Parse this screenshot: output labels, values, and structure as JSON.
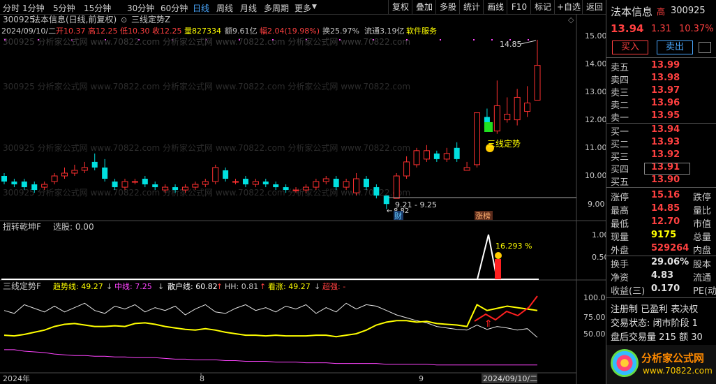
{
  "toolbar": {
    "periods": [
      "分时",
      "1分钟",
      "5分钟",
      "15分钟",
      "30分钟",
      "60分钟",
      "日线",
      "周线",
      "月线",
      "多周期",
      "更多"
    ],
    "active_period": "日线",
    "buttons": [
      "复权",
      "叠加",
      "多股",
      "统计",
      "画线",
      "F10",
      "标记",
      "+自选",
      "返回"
    ]
  },
  "main_chart": {
    "title_code": "300925",
    "title_name": "法本信息(日线,前复权)",
    "indicator_name": "三线定势Z",
    "info_date": "2024/09/10/二",
    "info_open": "开10.37",
    "info_high": "高12.25",
    "info_low": "低10.30",
    "info_close": "收12.25",
    "info_volume": "量827334",
    "info_amount": "额9.61亿",
    "info_change": "幅2.04(19.98%)",
    "info_turnover": "换25.97%",
    "info_float": "流通3.19亿",
    "info_sector": "软件服务",
    "price_axis": [
      "15.00",
      "14.00",
      "13.00",
      "12.00",
      "11.00",
      "10.00",
      "9.00"
    ],
    "annotation_high": "14.85",
    "annotation_low_range": "9.21 - 9.25",
    "annotation_low": "8.82",
    "signal_label": "三线定势",
    "badge_cai": "财",
    "badge_zhangting": "涨榜",
    "watermark": "300925 分析家公式网 www.70822.com 分析家公式网 www.70822.com 分析家公式网 www.70822.com"
  },
  "sub_chart1": {
    "title": "扭转乾坤F",
    "select_label": "选股: 0.00",
    "axis": [
      "1.00",
      "0.50"
    ],
    "peak_label": "16.293 %"
  },
  "sub_chart2": {
    "title": "三线定势F",
    "trend_label": "趋势线: 49.27",
    "mid_label": "中线: 7.25",
    "retail_label": "散户线: 60.82",
    "hh_label": "HH: 0.81",
    "rise_label": "看涨: 49.27",
    "strong_label": "超强: -",
    "axis": [
      "100.0",
      "75.00",
      "50.00"
    ],
    "x_axis": [
      "2024年",
      "8",
      "9",
      "2024/09/10/二"
    ]
  },
  "quote_panel": {
    "name": "法本信息",
    "tag": "高",
    "code": "300925",
    "price": "13.94",
    "change": "1.31",
    "change_pct": "10.37%",
    "buy_button": "买入",
    "sell_button": "卖出",
    "sell_levels": [
      {
        "label": "卖五",
        "price": "13.99"
      },
      {
        "label": "卖四",
        "price": "13.98"
      },
      {
        "label": "卖三",
        "price": "13.97"
      },
      {
        "label": "卖二",
        "price": "13.96"
      },
      {
        "label": "卖一",
        "price": "13.95"
      }
    ],
    "buy_levels": [
      {
        "label": "买一",
        "price": "13.94"
      },
      {
        "label": "买二",
        "price": "13.93"
      },
      {
        "label": "买三",
        "price": "13.92"
      },
      {
        "label": "买四",
        "price": "13.91"
      },
      {
        "label": "买五",
        "price": "13.90"
      }
    ],
    "stats": [
      {
        "label": "涨停",
        "value": "15.16",
        "extra": "跌停"
      },
      {
        "label": "最高",
        "value": "14.85",
        "extra": "量比"
      },
      {
        "label": "最低",
        "value": "12.70",
        "extra": "市值"
      },
      {
        "label": "现量",
        "value": "9175",
        "extra": "总量"
      },
      {
        "label": "外盘",
        "value": "529264",
        "extra": "内盘"
      }
    ],
    "stats2": [
      {
        "label": "换手",
        "value": "29.06%",
        "extra": "股本"
      },
      {
        "label": "净资",
        "value": "4.83",
        "extra": "流通"
      },
      {
        "label": "收益(三)",
        "value": "0.170",
        "extra": "PE(动"
      }
    ],
    "footer_line1": "注册制 已盈利 表决权",
    "footer_line2": "交易状态: 闭市阶段 1",
    "footer_line3": "盘后交易量 215 额 30",
    "logo_text": "分析家公式网",
    "logo_url": "www.70822.com"
  }
}
